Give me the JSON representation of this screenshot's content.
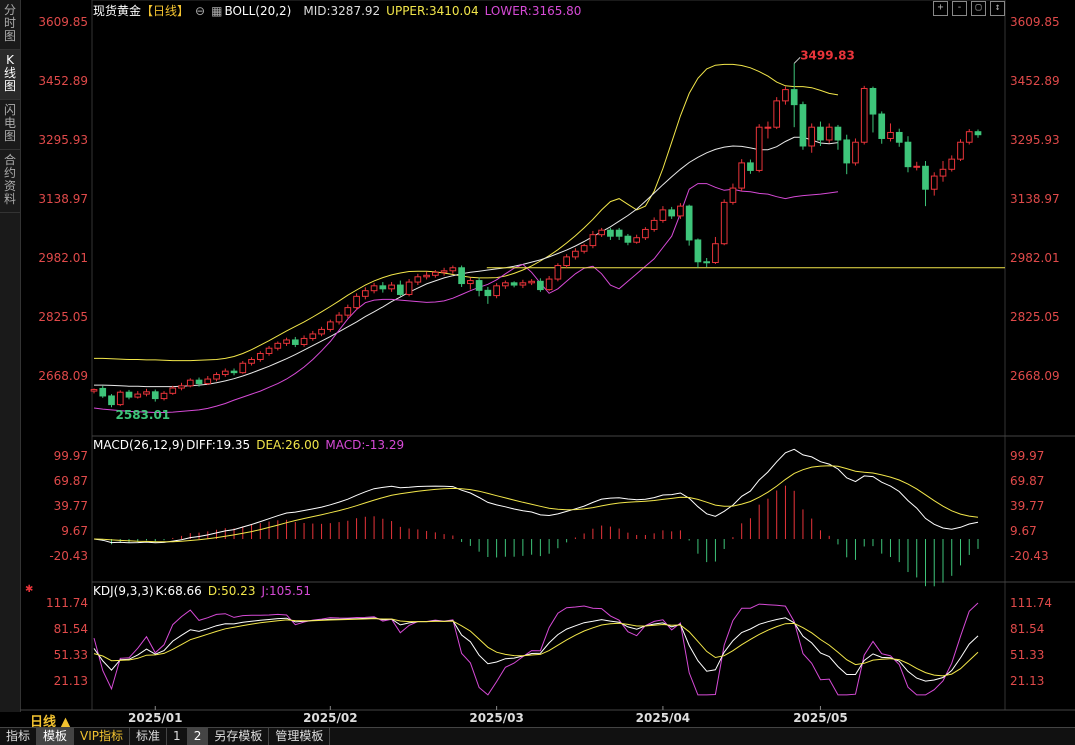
{
  "sidebar": {
    "tabs": [
      {
        "label": "分时图",
        "active": false
      },
      {
        "label": "K线图",
        "active": true
      },
      {
        "label": "闪电图",
        "active": false
      },
      {
        "label": "合约资料",
        "active": false
      }
    ]
  },
  "header": {
    "instrument": "现货黄金",
    "period_tag": "【日线】",
    "indicator": "BOLL(20,2)",
    "mid": "MID:3287.92",
    "upper": "UPPER:3410.04",
    "lower": "LOWER:3165.80"
  },
  "macd_header": {
    "name": "MACD(26,12,9)",
    "diff": "DIFF:19.35",
    "dea": "DEA:26.00",
    "macd": "MACD:-13.29"
  },
  "kdj_header": {
    "name": "KDJ(9,3,3)",
    "k": "K:68.66",
    "d": "D:50.23",
    "j": "J:105.51"
  },
  "window_buttons": [
    "+",
    "-",
    "▢",
    "↕"
  ],
  "period_button": "日线 ▲",
  "bottom_tabs": [
    {
      "label": "指标",
      "active": false,
      "vip": false
    },
    {
      "label": "模板",
      "active": true,
      "vip": false
    },
    {
      "label": "VIP指标",
      "active": false,
      "vip": true
    },
    {
      "label": "标准",
      "active": false,
      "vip": false
    },
    {
      "label": "1",
      "active": false,
      "vip": false
    },
    {
      "label": "2",
      "active": true,
      "vip": false
    },
    {
      "label": "另存模板",
      "active": false,
      "vip": false
    },
    {
      "label": "管理模板",
      "active": false,
      "vip": false
    }
  ],
  "colors": {
    "up": "#e8343a",
    "down": "#3ec57a",
    "mid_line": "#e8e8e8",
    "upper_line": "#f2e64a",
    "lower_line": "#d64ad6",
    "axis_text": "#e04a4a"
  },
  "chart_data": [
    {
      "type": "candlestick",
      "title": "现货黄金 日线",
      "y_ticks": [
        "3609.85",
        "3452.89",
        "3295.93",
        "3138.97",
        "2982.01",
        "2825.05",
        "2668.09"
      ],
      "ylim": [
        2560,
        3640
      ],
      "x_ticks": [
        "2025/01",
        "2025/02",
        "2025/03",
        "2025/04",
        "2025/05"
      ],
      "annotations": [
        {
          "label": "3499.83"
        },
        {
          "label": "2583.01"
        }
      ],
      "support_level": 2956,
      "mid": [
        2644,
        2644,
        2643,
        2642,
        2641,
        2641,
        2640,
        2640,
        2640,
        2640,
        2641,
        2642,
        2644,
        2646,
        2650,
        2655,
        2661,
        2668,
        2676,
        2685,
        2694,
        2704,
        2714,
        2725,
        2737,
        2749,
        2761,
        2773,
        2786,
        2799,
        2812,
        2826,
        2839,
        2852,
        2866,
        2878,
        2891,
        2902,
        2913,
        2921,
        2929,
        2935,
        2940,
        2944,
        2947,
        2950,
        2953,
        2956,
        2960,
        2965,
        2971,
        2977,
        2985,
        2994,
        3003,
        3014,
        3026,
        3039,
        3052,
        3065,
        3080,
        3095,
        3112,
        3133,
        3155,
        3177,
        3198,
        3218,
        3236,
        3250,
        3262,
        3271,
        3277,
        3280,
        3279,
        3275,
        3270,
        3270,
        3278,
        3292,
        3303,
        3303,
        3296,
        3288,
        3286,
        3289
      ],
      "upper": [
        2715,
        2715,
        2714,
        2713,
        2712,
        2712,
        2711,
        2711,
        2710,
        2709,
        2709,
        2709,
        2710,
        2711,
        2712,
        2715,
        2720,
        2728,
        2738,
        2750,
        2762,
        2775,
        2788,
        2800,
        2812,
        2825,
        2839,
        2853,
        2868,
        2883,
        2897,
        2910,
        2921,
        2930,
        2937,
        2942,
        2946,
        2947,
        2947,
        2945,
        2942,
        2938,
        2934,
        2931,
        2929,
        2929,
        2930,
        2934,
        2941,
        2950,
        2961,
        2974,
        2988,
        3004,
        3022,
        3041,
        3062,
        3085,
        3110,
        3132,
        3140,
        3125,
        3110,
        3120,
        3160,
        3220,
        3290,
        3360,
        3420,
        3460,
        3485,
        3495,
        3497,
        3497,
        3494,
        3488,
        3478,
        3466,
        3450,
        3440,
        3438,
        3438,
        3435,
        3428,
        3420,
        3416
      ],
      "lower": [
        2583,
        2580,
        2578,
        2576,
        2574,
        2573,
        2572,
        2571,
        2571,
        2572,
        2574,
        2576,
        2578,
        2582,
        2588,
        2595,
        2604,
        2612,
        2620,
        2628,
        2638,
        2648,
        2660,
        2675,
        2692,
        2712,
        2735,
        2760,
        2790,
        2820,
        2845,
        2863,
        2870,
        2872,
        2872,
        2870,
        2868,
        2866,
        2864,
        2865,
        2868,
        2875,
        2885,
        2895,
        2904,
        2912,
        2924,
        2940,
        2955,
        2965,
        2944,
        2915,
        2888,
        2900,
        2920,
        2940,
        2955,
        2960,
        2940,
        2910,
        2900,
        2920,
        2940,
        2960,
        2980,
        3010,
        3040,
        3100,
        3165,
        3180,
        3180,
        3170,
        3162,
        3165,
        3160,
        3158,
        3154,
        3152,
        3145,
        3140,
        3145,
        3148,
        3150,
        3152,
        3155,
        3158
      ],
      "candles": [
        [
          2628,
          2632,
          2622,
          2635
        ],
        [
          2635,
          2615,
          2610,
          2642
        ],
        [
          2615,
          2592,
          2585,
          2620
        ],
        [
          2592,
          2625,
          2588,
          2630
        ],
        [
          2625,
          2612,
          2606,
          2631
        ],
        [
          2612,
          2620,
          2608,
          2628
        ],
        [
          2620,
          2626,
          2614,
          2634
        ],
        [
          2626,
          2608,
          2600,
          2632
        ],
        [
          2608,
          2622,
          2603,
          2628
        ],
        [
          2622,
          2636,
          2618,
          2642
        ],
        [
          2636,
          2642,
          2630,
          2650
        ],
        [
          2642,
          2657,
          2638,
          2662
        ],
        [
          2657,
          2648,
          2640,
          2664
        ],
        [
          2648,
          2660,
          2644,
          2668
        ],
        [
          2660,
          2672,
          2654,
          2678
        ],
        [
          2672,
          2681,
          2666,
          2688
        ],
        [
          2681,
          2677,
          2670,
          2688
        ],
        [
          2677,
          2702,
          2674,
          2708
        ],
        [
          2702,
          2712,
          2696,
          2718
        ],
        [
          2712,
          2728,
          2706,
          2734
        ],
        [
          2728,
          2742,
          2722,
          2748
        ],
        [
          2742,
          2755,
          2736,
          2760
        ],
        [
          2755,
          2764,
          2748,
          2770
        ],
        [
          2764,
          2752,
          2745,
          2772
        ],
        [
          2752,
          2768,
          2746,
          2776
        ],
        [
          2768,
          2780,
          2762,
          2788
        ],
        [
          2780,
          2792,
          2774,
          2799
        ],
        [
          2792,
          2812,
          2786,
          2818
        ],
        [
          2812,
          2830,
          2805,
          2838
        ],
        [
          2830,
          2850,
          2822,
          2858
        ],
        [
          2850,
          2880,
          2844,
          2888
        ],
        [
          2880,
          2895,
          2872,
          2904
        ],
        [
          2895,
          2908,
          2888,
          2916
        ],
        [
          2908,
          2900,
          2890,
          2918
        ],
        [
          2900,
          2910,
          2892,
          2918
        ],
        [
          2910,
          2885,
          2880,
          2922
        ],
        [
          2885,
          2918,
          2880,
          2926
        ],
        [
          2918,
          2932,
          2910,
          2940
        ],
        [
          2932,
          2936,
          2925,
          2946
        ],
        [
          2936,
          2944,
          2930,
          2950
        ],
        [
          2944,
          2948,
          2935,
          2956
        ],
        [
          2948,
          2956,
          2940,
          2962
        ],
        [
          2956,
          2914,
          2905,
          2962
        ],
        [
          2914,
          2922,
          2898,
          2930
        ],
        [
          2922,
          2896,
          2880,
          2930
        ],
        [
          2896,
          2882,
          2860,
          2905
        ],
        [
          2882,
          2908,
          2875,
          2915
        ],
        [
          2908,
          2916,
          2900,
          2922
        ],
        [
          2916,
          2910,
          2904,
          2920
        ],
        [
          2910,
          2916,
          2902,
          2924
        ],
        [
          2916,
          2920,
          2910,
          2926
        ],
        [
          2920,
          2898,
          2892,
          2928
        ],
        [
          2898,
          2926,
          2894,
          2934
        ],
        [
          2926,
          2962,
          2920,
          2968
        ],
        [
          2962,
          2985,
          2955,
          2992
        ],
        [
          2985,
          3000,
          2978,
          3008
        ],
        [
          3000,
          3015,
          2994,
          3020
        ],
        [
          3015,
          3044,
          3008,
          3054
        ],
        [
          3044,
          3056,
          3038,
          3062
        ],
        [
          3056,
          3040,
          3030,
          3062
        ],
        [
          3056,
          3040,
          3030,
          3062
        ],
        [
          3040,
          3024,
          3016,
          3046
        ],
        [
          3024,
          3036,
          3020,
          3044
        ],
        [
          3036,
          3058,
          3030,
          3064
        ],
        [
          3058,
          3082,
          3052,
          3090
        ],
        [
          3082,
          3110,
          3076,
          3120
        ],
        [
          3110,
          3094,
          3086,
          3118
        ],
        [
          3094,
          3120,
          3086,
          3128
        ],
        [
          3120,
          3030,
          3015,
          3124
        ],
        [
          3030,
          2972,
          2956,
          3034
        ],
        [
          2972,
          2970,
          2958,
          2982
        ],
        [
          2970,
          3020,
          2966,
          3038
        ],
        [
          3020,
          3130,
          3016,
          3138
        ],
        [
          3130,
          3168,
          3124,
          3180
        ],
        [
          3168,
          3235,
          3160,
          3245
        ],
        [
          3235,
          3215,
          3206,
          3244
        ],
        [
          3215,
          3330,
          3210,
          3338
        ],
        [
          3330,
          3330,
          3300,
          3345
        ],
        [
          3330,
          3400,
          3325,
          3410
        ],
        [
          3400,
          3430,
          3390,
          3438
        ],
        [
          3430,
          3390,
          3330,
          3500
        ],
        [
          3390,
          3280,
          3270,
          3398
        ],
        [
          3280,
          3330,
          3262,
          3340
        ],
        [
          3330,
          3296,
          3280,
          3345
        ],
        [
          3296,
          3330,
          3288,
          3340
        ],
        [
          3330,
          3296,
          3270,
          3336
        ],
        [
          3296,
          3235,
          3205,
          3310
        ],
        [
          3235,
          3290,
          3228,
          3300
        ],
        [
          3290,
          3433,
          3284,
          3440
        ],
        [
          3433,
          3365,
          3316,
          3438
        ],
        [
          3365,
          3300,
          3286,
          3372
        ],
        [
          3300,
          3316,
          3292,
          3340
        ],
        [
          3316,
          3290,
          3278,
          3326
        ],
        [
          3290,
          3225,
          3210,
          3306
        ],
        [
          3225,
          3226,
          3215,
          3238
        ],
        [
          3226,
          3165,
          3120,
          3240
        ],
        [
          3165,
          3200,
          3148,
          3210
        ],
        [
          3200,
          3218,
          3185,
          3240
        ],
        [
          3218,
          3245,
          3212,
          3255
        ],
        [
          3245,
          3290,
          3240,
          3298
        ],
        [
          3290,
          3318,
          3284,
          3325
        ],
        [
          3318,
          3310,
          3302,
          3324
        ]
      ]
    },
    {
      "type": "bar_line",
      "title": "MACD(26,12,9)",
      "y_ticks": [
        "99.97",
        "69.87",
        "39.77",
        "9.67",
        "-20.43"
      ],
      "ylim": [
        -32,
        110
      ]
    },
    {
      "type": "line",
      "title": "KDJ(9,3,3)",
      "y_ticks": [
        "111.74",
        "81.54",
        "51.33",
        "21.13"
      ],
      "ylim": [
        5,
        118
      ]
    }
  ]
}
